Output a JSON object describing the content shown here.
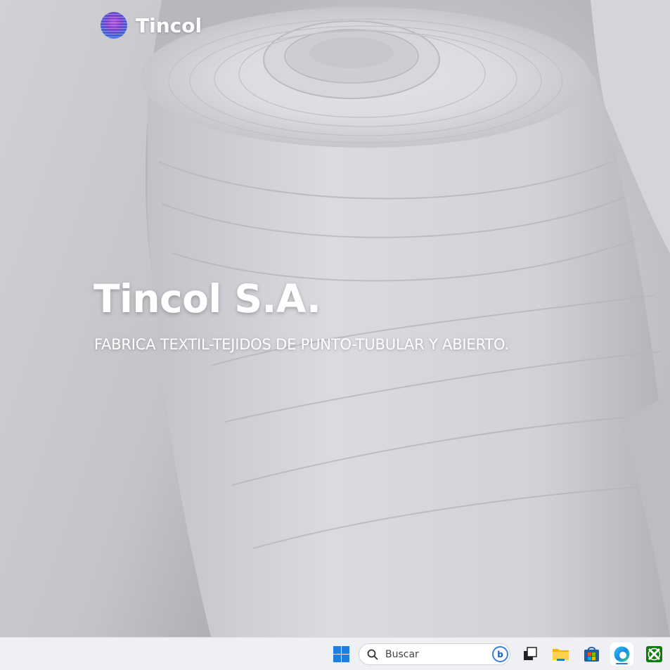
{
  "brand": {
    "name": "Tincol",
    "logo_icon": "tincol-logo-icon"
  },
  "hero": {
    "title": "Tincol S.A.",
    "subtitle": "FABRICA TEXTIL-TEJIDOS DE PUNTO-TUBULAR Y ABIERTO.",
    "background": "fabric-rolls-photo"
  },
  "taskbar": {
    "search_placeholder": "Buscar",
    "bing_label": "b",
    "icons": [
      "windows-start-icon",
      "search-icon",
      "bing-icon",
      "task-view-icon",
      "file-explorer-icon",
      "microsoft-store-icon",
      "edge-browser-icon",
      "xbox-icon"
    ],
    "colors": {
      "start_blue": "#1f7fe0",
      "taskbar_bg": "#eef0f4"
    }
  }
}
